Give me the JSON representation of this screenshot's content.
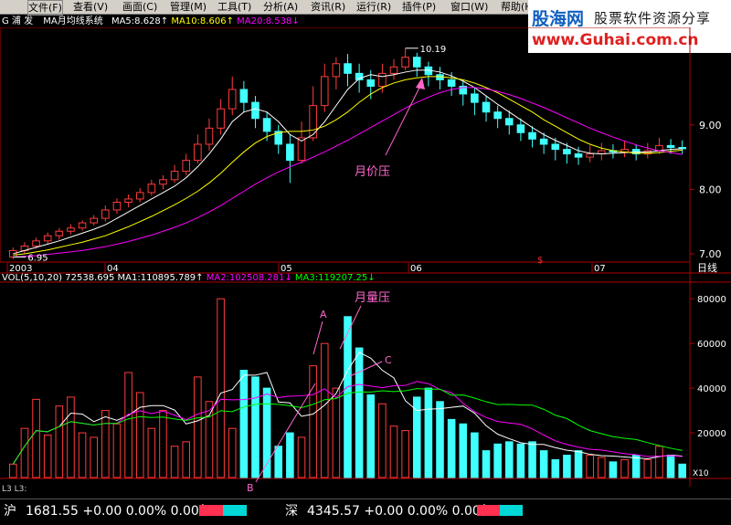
{
  "menu": [
    "文件(F)",
    "查看(V)",
    "画面(C)",
    "管理(M)",
    "工具(T)",
    "分析(A)",
    "资讯(R)",
    "运行(R)",
    "插件(P)",
    "窗口(W)",
    "帮助(H)"
  ],
  "logo": {
    "brand": "股海网",
    "tagline": "股票软件资源分享",
    "url": "www.Guhai.com.cn"
  },
  "infobar": {
    "code": "G 浦  发",
    "system": "MA月均线系统",
    "ma5": "MA5:8.628",
    "ma10": "MA10:8.606",
    "ma20": "MA20:8.538",
    "colors": {
      "label": "#ffffff",
      "ma5": "#ffffff",
      "ma10": "#ffff00",
      "ma20": "#ff00ff"
    }
  },
  "volbar": {
    "vol": "VOL(5,10,20) 72538.695",
    "ma1": "MA1:110895.789",
    "ma2": "MA2:102508.281",
    "ma3": "MA3:119207.25",
    "colors": {
      "vol": "#ffffff",
      "ma1": "#ffffff",
      "ma2": "#ff00ff",
      "ma3": "#00ff00"
    }
  },
  "price_axis": [
    "9.00",
    "8.00",
    "7.00"
  ],
  "vol_axis": [
    "80000",
    "60000",
    "40000",
    "20000",
    "X10"
  ],
  "time_axis": [
    "2003",
    "04",
    "05",
    "06",
    "07",
    "日线"
  ],
  "annotations": {
    "high": "10.19",
    "low": "6.95",
    "month_price": "月价压",
    "month_vol": "月量压",
    "A": "A",
    "B": "B",
    "C": "C",
    "dollar": "$"
  },
  "status": {
    "l3": "L3 L3:",
    "sh_label": "沪",
    "sh_value": "1681.55 +0.00 0.00% 0.00亿",
    "sz_label": "深",
    "sz_value": "4345.57 +0.00 0.00% 0.00亿"
  },
  "chart_data": {
    "type": "candlestick+volume",
    "price_ylim": [
      6.9,
      10.4
    ],
    "vol_ylim": [
      0,
      85000
    ],
    "candles": [
      [
        6.95,
        7.05,
        6.92,
        7.1
      ],
      [
        7.05,
        7.12,
        7.0,
        7.18
      ],
      [
        7.12,
        7.2,
        7.08,
        7.25
      ],
      [
        7.2,
        7.28,
        7.15,
        7.33
      ],
      [
        7.28,
        7.35,
        7.22,
        7.4
      ],
      [
        7.35,
        7.4,
        7.3,
        7.46
      ],
      [
        7.4,
        7.48,
        7.36,
        7.52
      ],
      [
        7.48,
        7.55,
        7.44,
        7.6
      ],
      [
        7.55,
        7.68,
        7.5,
        7.75
      ],
      [
        7.68,
        7.8,
        7.62,
        7.86
      ],
      [
        7.8,
        7.85,
        7.72,
        7.92
      ],
      [
        7.85,
        7.95,
        7.8,
        8.02
      ],
      [
        7.95,
        8.08,
        7.9,
        8.15
      ],
      [
        8.08,
        8.15,
        8.0,
        8.22
      ],
      [
        8.15,
        8.28,
        8.1,
        8.38
      ],
      [
        8.28,
        8.45,
        8.22,
        8.55
      ],
      [
        8.45,
        8.7,
        8.4,
        8.85
      ],
      [
        8.7,
        8.95,
        8.6,
        9.1
      ],
      [
        8.95,
        9.25,
        8.85,
        9.4
      ],
      [
        9.25,
        9.55,
        9.15,
        9.75
      ],
      [
        9.55,
        9.35,
        9.2,
        9.68
      ],
      [
        9.35,
        9.1,
        8.95,
        9.45
      ],
      [
        9.1,
        8.9,
        8.75,
        9.2
      ],
      [
        8.9,
        8.7,
        8.55,
        9.0
      ],
      [
        8.7,
        8.45,
        8.1,
        8.85
      ],
      [
        8.45,
        8.8,
        8.4,
        9.05
      ],
      [
        8.8,
        9.3,
        8.75,
        9.6
      ],
      [
        9.3,
        9.75,
        9.2,
        9.95
      ],
      [
        9.75,
        9.95,
        9.55,
        10.05
      ],
      [
        9.95,
        9.8,
        9.6,
        10.1
      ],
      [
        9.8,
        9.7,
        9.5,
        9.95
      ],
      [
        9.7,
        9.6,
        9.4,
        9.85
      ],
      [
        9.6,
        9.8,
        9.5,
        9.95
      ],
      [
        9.8,
        9.9,
        9.7,
        10.02
      ],
      [
        9.9,
        10.05,
        9.85,
        10.19
      ],
      [
        10.05,
        9.9,
        9.75,
        10.12
      ],
      [
        9.9,
        9.78,
        9.6,
        9.98
      ],
      [
        9.78,
        9.7,
        9.55,
        9.9
      ],
      [
        9.7,
        9.6,
        9.45,
        9.82
      ],
      [
        9.6,
        9.48,
        9.3,
        9.7
      ],
      [
        9.48,
        9.35,
        9.15,
        9.58
      ],
      [
        9.35,
        9.2,
        9.05,
        9.45
      ],
      [
        9.2,
        9.1,
        8.95,
        9.3
      ],
      [
        9.1,
        9.0,
        8.85,
        9.22
      ],
      [
        9.0,
        8.88,
        8.75,
        9.1
      ],
      [
        8.88,
        8.78,
        8.65,
        8.98
      ],
      [
        8.78,
        8.7,
        8.55,
        8.88
      ],
      [
        8.7,
        8.62,
        8.45,
        8.8
      ],
      [
        8.62,
        8.55,
        8.4,
        8.72
      ],
      [
        8.55,
        8.5,
        8.38,
        8.66
      ],
      [
        8.5,
        8.55,
        8.42,
        8.68
      ],
      [
        8.55,
        8.6,
        8.45,
        8.72
      ],
      [
        8.6,
        8.58,
        8.48,
        8.7
      ],
      [
        8.58,
        8.62,
        8.5,
        8.75
      ],
      [
        8.62,
        8.55,
        8.45,
        8.7
      ],
      [
        8.55,
        8.6,
        8.48,
        8.72
      ],
      [
        8.6,
        8.68,
        8.55,
        8.8
      ],
      [
        8.68,
        8.65,
        8.55,
        8.78
      ],
      [
        8.65,
        8.63,
        8.55,
        8.76
      ]
    ],
    "ma5": [
      7.0,
      7.05,
      7.1,
      7.15,
      7.2,
      7.26,
      7.32,
      7.38,
      7.45,
      7.55,
      7.65,
      7.75,
      7.85,
      7.95,
      8.05,
      8.18,
      8.35,
      8.55,
      8.78,
      9.05,
      9.2,
      9.25,
      9.2,
      9.05,
      8.85,
      8.75,
      8.85,
      9.05,
      9.3,
      9.55,
      9.72,
      9.78,
      9.75,
      9.78,
      9.82,
      9.85,
      9.85,
      9.82,
      9.76,
      9.68,
      9.58,
      9.45,
      9.32,
      9.2,
      9.08,
      8.96,
      8.85,
      8.76,
      8.68,
      8.6,
      8.56,
      8.55,
      8.56,
      8.57,
      8.58,
      8.58,
      8.6,
      8.62,
      8.63
    ],
    "ma10": [
      6.98,
      7.0,
      7.03,
      7.06,
      7.1,
      7.14,
      7.18,
      7.23,
      7.28,
      7.35,
      7.42,
      7.5,
      7.58,
      7.67,
      7.76,
      7.86,
      7.97,
      8.1,
      8.25,
      8.42,
      8.58,
      8.72,
      8.82,
      8.88,
      8.9,
      8.9,
      8.92,
      8.98,
      9.08,
      9.2,
      9.35,
      9.48,
      9.58,
      9.65,
      9.7,
      9.73,
      9.75,
      9.75,
      9.73,
      9.7,
      9.65,
      9.58,
      9.5,
      9.4,
      9.3,
      9.2,
      9.08,
      8.98,
      8.88,
      8.78,
      8.7,
      8.64,
      8.6,
      8.58,
      8.56,
      8.56,
      8.57,
      8.59,
      8.61
    ],
    "ma20": [
      6.95,
      6.96,
      6.97,
      6.99,
      7.01,
      7.03,
      7.05,
      7.08,
      7.11,
      7.15,
      7.19,
      7.24,
      7.29,
      7.35,
      7.41,
      7.48,
      7.56,
      7.65,
      7.75,
      7.86,
      7.97,
      8.08,
      8.18,
      8.27,
      8.35,
      8.42,
      8.5,
      8.58,
      8.67,
      8.76,
      8.86,
      8.96,
      9.06,
      9.16,
      9.26,
      9.35,
      9.43,
      9.5,
      9.55,
      9.58,
      9.58,
      9.56,
      9.52,
      9.47,
      9.41,
      9.34,
      9.27,
      9.19,
      9.11,
      9.03,
      8.95,
      8.88,
      8.81,
      8.75,
      8.69,
      8.64,
      8.6,
      8.57,
      8.54
    ],
    "volume": [
      6000,
      22000,
      35000,
      19000,
      32000,
      36000,
      20000,
      18000,
      30000,
      24000,
      47000,
      38000,
      22000,
      30000,
      14000,
      16000,
      45000,
      34000,
      80000,
      22000,
      48000,
      45000,
      40000,
      14000,
      20000,
      18000,
      50000,
      60000,
      40000,
      72000,
      58000,
      37000,
      33000,
      23000,
      21000,
      36000,
      40000,
      34000,
      26000,
      24000,
      20000,
      12000,
      15000,
      16000,
      15000,
      16000,
      12000,
      8000,
      10000,
      12000,
      10000,
      9000,
      7000,
      8000,
      10000,
      8000,
      14000,
      10000,
      6000
    ]
  }
}
